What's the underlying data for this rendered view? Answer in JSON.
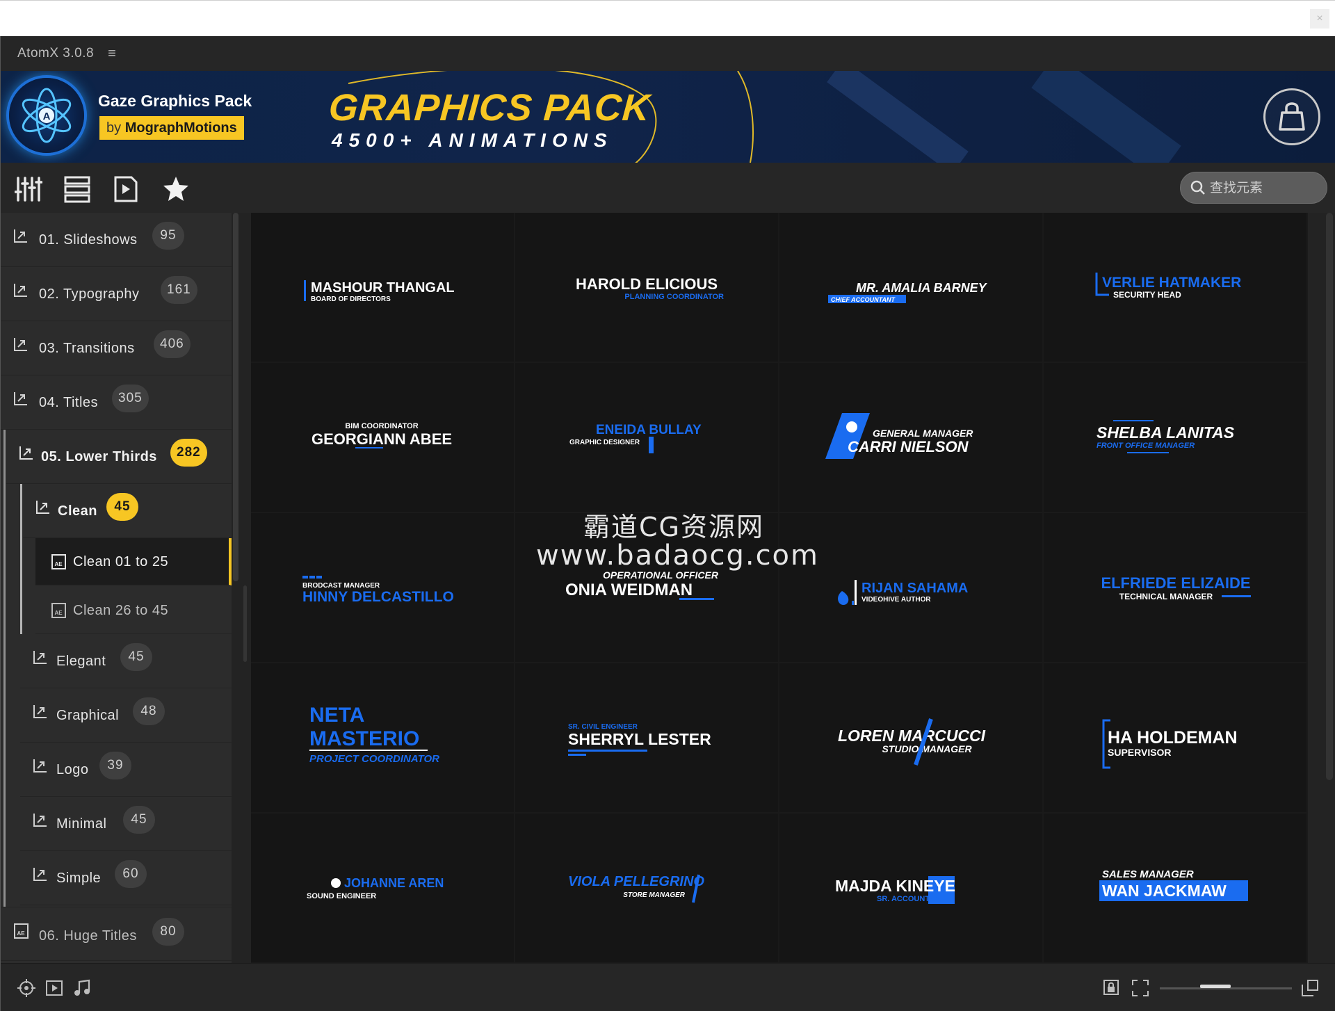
{
  "window": {
    "close_label": "×"
  },
  "app": {
    "title": "AtomX 3.0.8",
    "menu_glyph": "≡"
  },
  "banner": {
    "pack_name": "Gaze Graphics Pack",
    "by_prefix": "by",
    "author": "MographMotions",
    "title": "GRAPHICS PACK",
    "subtitle": "4500+ ANIMATIONS",
    "accent": "#f7c623"
  },
  "toolbar": {
    "tools": [
      "sliders-icon",
      "list-icon",
      "play-file-icon",
      "star-icon"
    ],
    "search_placeholder": "查找元素"
  },
  "sidebar": {
    "items": [
      {
        "label": "01. Slideshows",
        "count": "95"
      },
      {
        "label": "02. Typography",
        "count": "161"
      },
      {
        "label": "03. Transitions",
        "count": "406"
      },
      {
        "label": "04. Titles",
        "count": "305"
      },
      {
        "label": "05. Lower Thirds",
        "count": "282",
        "expanded": true
      },
      {
        "label": "Clean",
        "count": "45",
        "expanded": true
      },
      {
        "label": "Clean 01 to 25",
        "selected": true
      },
      {
        "label": "Clean 26 to 45"
      },
      {
        "label": "Elegant",
        "count": "45"
      },
      {
        "label": "Graphical",
        "count": "48"
      },
      {
        "label": "Logo",
        "count": "39"
      },
      {
        "label": "Minimal",
        "count": "45"
      },
      {
        "label": "Simple",
        "count": "60"
      },
      {
        "label": "06. Huge Titles",
        "count": "80"
      }
    ]
  },
  "grid": {
    "accent_blue": "#1a6cf0",
    "cells": [
      {
        "name": "MASHOUR THANGAL",
        "role": "BOARD OF DIRECTORS"
      },
      {
        "name": "HAROLD ELICIOUS",
        "role": "PLANNING COORDINATOR"
      },
      {
        "name": "MR. AMALIA BARNEY",
        "role": "CHIEF ACCOUNTANT"
      },
      {
        "name": "VERLIE HATMAKER",
        "role": "SECURITY HEAD"
      },
      {
        "name": "GEORGIANN ABEE",
        "role": "BIM COORDINATOR"
      },
      {
        "name": "ENEIDA BULLAY",
        "role": "GRAPHIC DESIGNER"
      },
      {
        "name": "CARRI NIELSON",
        "role": "GENERAL MANAGER"
      },
      {
        "name": "SHELBA LANITAS",
        "role": "FRONT OFFICE MANAGER"
      },
      {
        "name": "HINNY DELCASTILLO",
        "role": "BRODCAST MANAGER"
      },
      {
        "name": "ONIA WEIDMAN",
        "role": "OPERATIONAL OFFICER"
      },
      {
        "name": "RIJAN SAHAMA",
        "role": "VIDEOHIVE AUTHOR"
      },
      {
        "name": "ELFRIEDE ELIZAIDE",
        "role": "TECHNICAL MANAGER"
      },
      {
        "name": "NETA",
        "name2": "MASTERIO",
        "role": "PROJECT COORDINATOR"
      },
      {
        "name": "SHERRYL LESTER",
        "role": "SR. CIVIL ENGINEER"
      },
      {
        "name": "LOREN MARCUCCI",
        "role": "STUDIO MANAGER"
      },
      {
        "name": "HA HOLDEMAN",
        "role": "SUPERVISOR"
      },
      {
        "name": "JOHANNE AREN",
        "role": "SOUND ENGINEER"
      },
      {
        "name": "VIOLA PELLEGRINO",
        "role": "STORE MANAGER"
      },
      {
        "name": "MAJDA KINEYE",
        "role": "SR. ACCOUNTANT"
      },
      {
        "name": "WAN JACKMAW",
        "role": "SALES MANAGER"
      }
    ]
  },
  "watermark": {
    "line1": "霸道CG资源网",
    "line2": "www.badaocg.com"
  },
  "bottombar": {
    "icons": [
      "target-icon",
      "video-icon",
      "music-icon",
      "lock-icon",
      "fit-icon",
      "expand-icon"
    ]
  }
}
